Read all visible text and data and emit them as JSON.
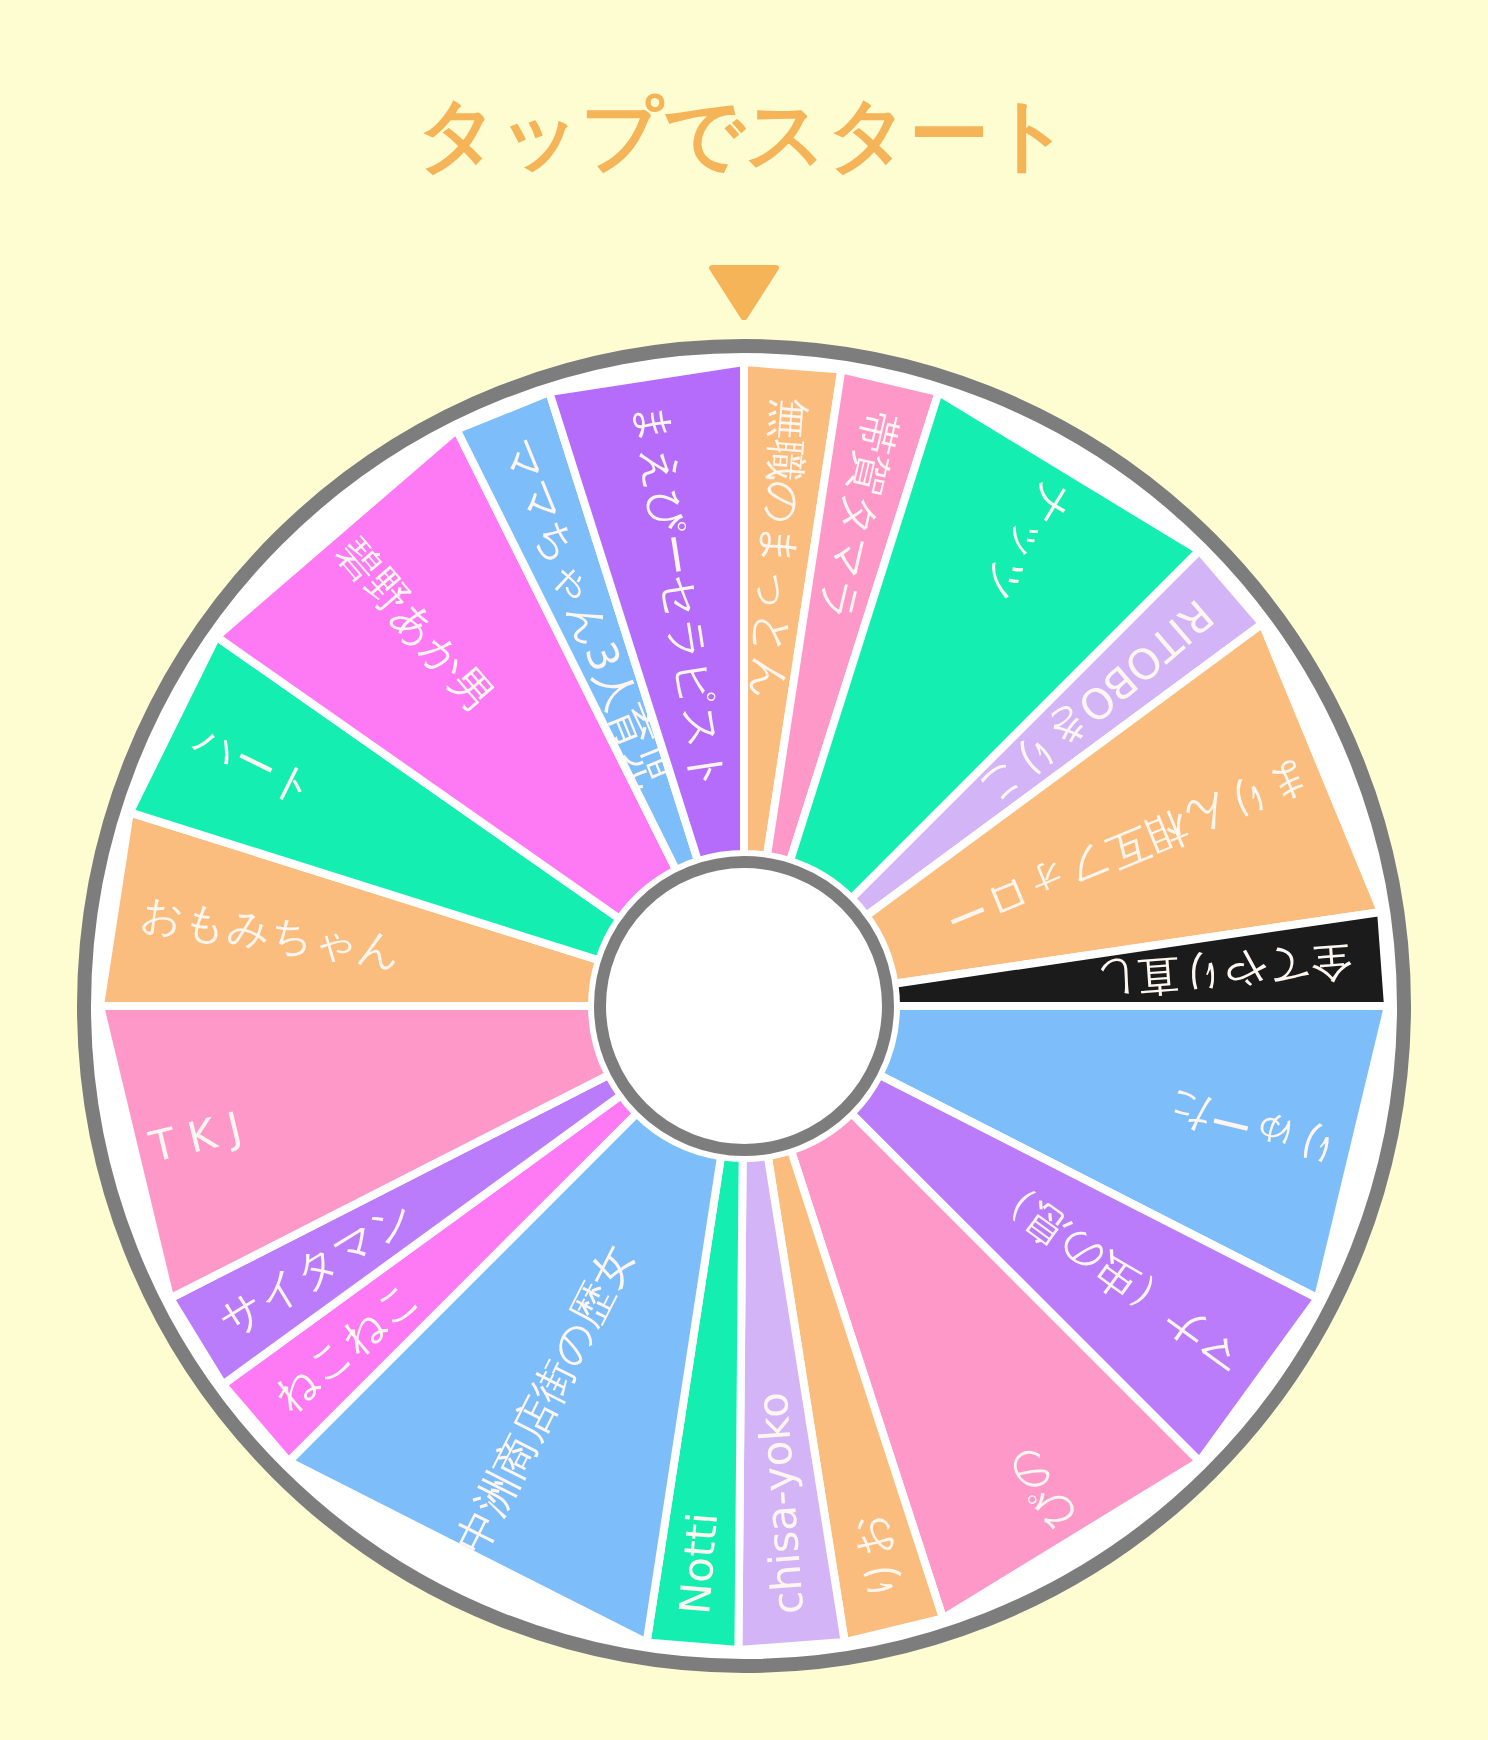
{
  "title": "タップでスタート",
  "segments": [
    {
      "label": "無職のまっとん",
      "color": "#fbbd7e"
    },
    {
      "label": "帯賀タマラ",
      "color": "#fe98c8"
    },
    {
      "label": "ナッツ",
      "color": "#14efb1"
    },
    {
      "label": "RITOBOきりこ",
      "color": "#d3b4f7"
    },
    {
      "label": "まりん相互フォロー",
      "color": "#fbbd7e"
    },
    {
      "label": "全てやり直し",
      "color": "#1b1b1b"
    },
    {
      "label": "りゅーた",
      "color": "#7dbdfa"
    },
    {
      "label": "マナ（虫の息）",
      "color": "#ba7cfb"
    },
    {
      "label": "ぴの",
      "color": "#fe98c8"
    },
    {
      "label": "りお",
      "color": "#fbbd7e"
    },
    {
      "label": "chisa-yoko",
      "color": "#d3b4f7"
    },
    {
      "label": "Notti",
      "color": "#14efb1"
    },
    {
      "label": "中洲商店街の歴女",
      "color": "#7dbdfa"
    },
    {
      "label": "ねこねこ",
      "color": "#fe7af5"
    },
    {
      "label": "サイタマン",
      "color": "#ba7cfb"
    },
    {
      "label": "T K J",
      "color": "#fe98c8"
    },
    {
      "label": "おもみちゃん",
      "color": "#fbbd7e"
    },
    {
      "label": "ハート",
      "color": "#14efb1"
    },
    {
      "label": "碧野あか男",
      "color": "#fe7af5"
    },
    {
      "label": "ママちゃん3人育児",
      "color": "#7dbdfa"
    },
    {
      "label": "まえぴーセラピスト",
      "color": "#b56cfb"
    }
  ]
}
